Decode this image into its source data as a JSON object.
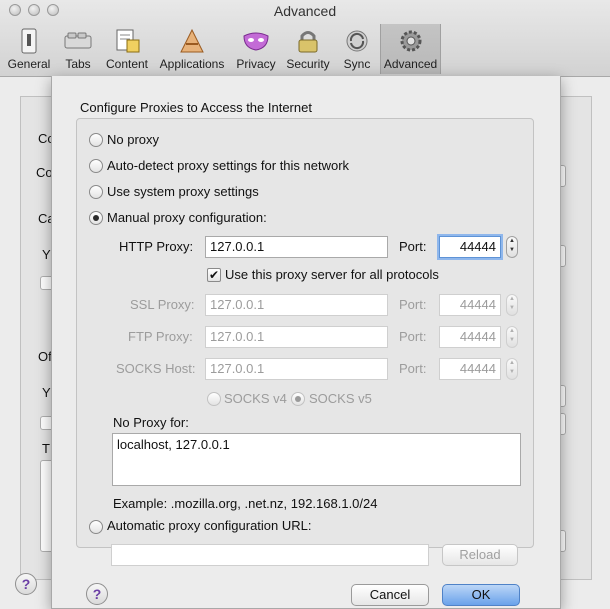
{
  "window": {
    "title": "Advanced"
  },
  "toolbar": {
    "items": [
      {
        "label": "General",
        "icon": "general-icon"
      },
      {
        "label": "Tabs",
        "icon": "tabs-icon"
      },
      {
        "label": "Content",
        "icon": "content-icon"
      },
      {
        "label": "Applications",
        "icon": "applications-icon"
      },
      {
        "label": "Privacy",
        "icon": "privacy-mask-icon"
      },
      {
        "label": "Security",
        "icon": "lock-icon"
      },
      {
        "label": "Sync",
        "icon": "sync-icon"
      },
      {
        "label": "Advanced",
        "icon": "gear-icon"
      }
    ],
    "active": "Advanced"
  },
  "background": {
    "fragments": [
      "Co",
      "Co",
      "Ca",
      "Y",
      "Of",
      "Y",
      "T"
    ]
  },
  "sheet": {
    "title": "Configure Proxies to Access the Internet",
    "options": {
      "no_proxy": "No proxy",
      "auto_detect": "Auto-detect proxy settings for this network",
      "system": "Use system proxy settings",
      "manual": "Manual proxy configuration:"
    },
    "selected_option": "manual",
    "http": {
      "label": "HTTP Proxy:",
      "value": "127.0.0.1",
      "port_label": "Port:",
      "port": "44444"
    },
    "use_for_all": {
      "label": "Use this proxy server for all protocols",
      "checked": true
    },
    "ssl": {
      "label": "SSL Proxy:",
      "value": "127.0.0.1",
      "port_label": "Port:",
      "port": "44444"
    },
    "ftp": {
      "label": "FTP Proxy:",
      "value": "127.0.0.1",
      "port_label": "Port:",
      "port": "44444"
    },
    "socks": {
      "label": "SOCKS Host:",
      "value": "127.0.0.1",
      "port_label": "Port:",
      "port": "44444"
    },
    "socks_v4": "SOCKS v4",
    "socks_v5": "SOCKS v5",
    "socks_version_selected": "v5",
    "no_proxy_for": {
      "label": "No Proxy for:",
      "value": "localhost, 127.0.0.1"
    },
    "example": "Example: .mozilla.org, .net.nz, 192.168.1.0/24",
    "auto_config": {
      "label": "Automatic proxy configuration URL:",
      "value": "",
      "reload": "Reload"
    },
    "buttons": {
      "cancel": "Cancel",
      "ok": "OK",
      "help": "?"
    }
  },
  "colors": {
    "accent": "#6aa2ea",
    "focus_ring": "#8fb7ec",
    "help": "#6b3fa5"
  }
}
